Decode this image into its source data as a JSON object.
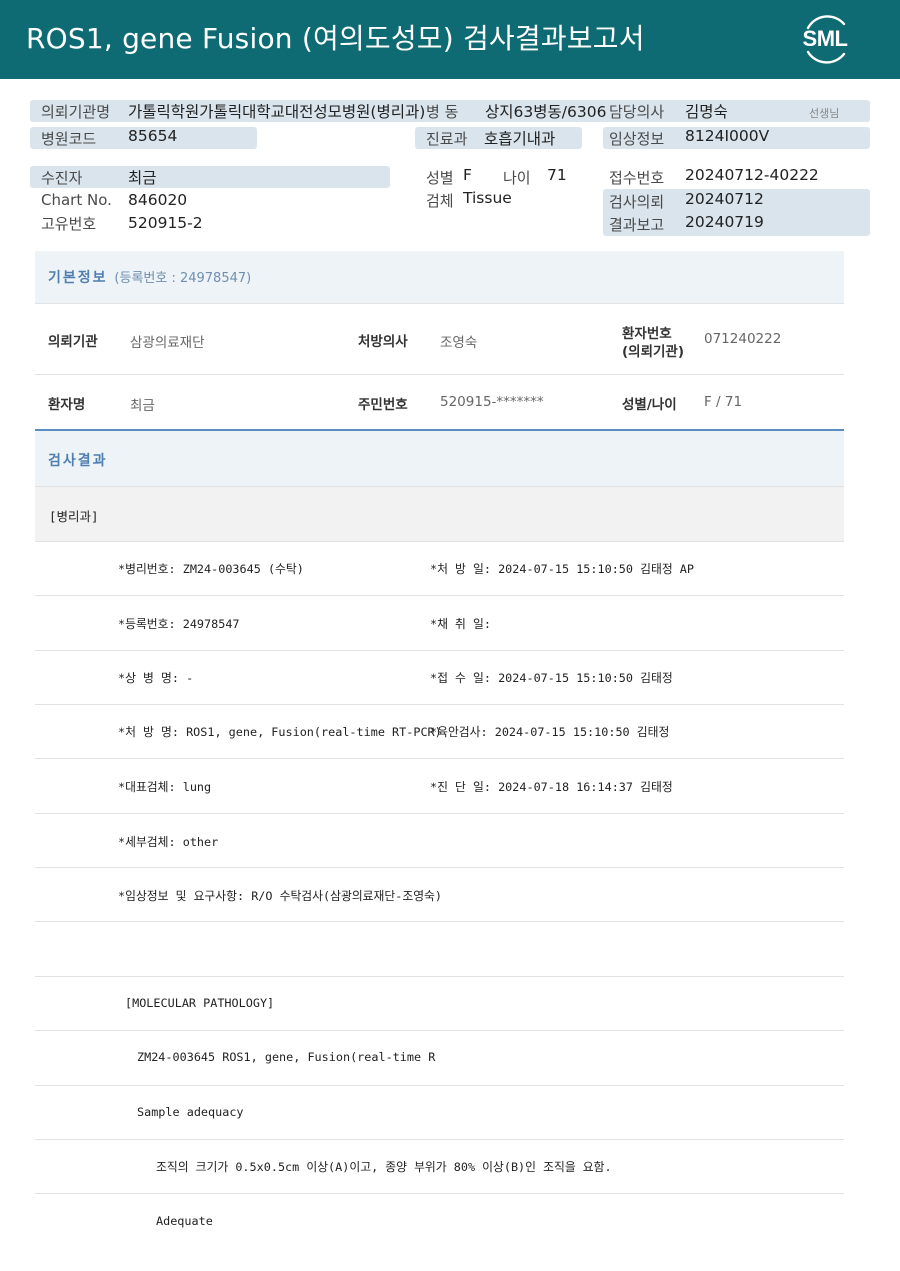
{
  "header": {
    "title": "ROS1, gene Fusion (여의도성모) 검사결과보고서",
    "logo_text": "SML",
    "bg_color": "#0e6b73"
  },
  "top_info": {
    "requester_label": "의뢰기관명",
    "requester_value": "가톨릭학원가톨릭대학교대전성모병원(병리과)",
    "ward_label": "병 동",
    "ward_value": "상지63병동/6306",
    "doctor_label": "담당의사",
    "doctor_value": "김명숙",
    "doctor_suffix": "선생님",
    "hospital_code_label": "병원코드",
    "hospital_code_value": "85654",
    "dept_label": "진료과",
    "dept_value": "호흡기내과",
    "clinical_label": "임상정보",
    "clinical_value": "8124I000V",
    "patient_label": "수진자",
    "patient_value": "최금",
    "chart_label": "Chart No.",
    "chart_value": "846020",
    "unique_label": "고유번호",
    "unique_value": "520915-2",
    "sex_label": "성별",
    "sex_value": "F",
    "age_label": "나이",
    "age_value": "71",
    "specimen_label": "검체",
    "specimen_value": "Tissue",
    "receipt_label": "접수번호",
    "receipt_value": "20240712-40222",
    "request_label": "검사의뢰",
    "request_value": "20240712",
    "report_label": "결과보고",
    "report_value": "20240719"
  },
  "basic_info": {
    "title": "기본정보",
    "reg_sub": "(등록번호 : 24978547)",
    "inst_label": "의뢰기관",
    "inst_value": "삼광의료재단",
    "presc_label": "처방의사",
    "presc_value": "조영숙",
    "ptno_label_1": "환자번호",
    "ptno_label_2": "(의뢰기관)",
    "ptno_value": "071240222",
    "name_label": "환자명",
    "name_value": "최금",
    "rrn_label": "주민번호",
    "rrn_value": "520915-*******",
    "sexage_label": "성별/나이",
    "sexage_value": "F / 71"
  },
  "results": {
    "title": "검사결과",
    "dept": "[병리과]",
    "rows": [
      {
        "left": "*병리번호: ZM24-003645 (수탁)",
        "right": "*처 방 일: 2024-07-15 15:10:50  김태정 AP"
      },
      {
        "left": "*등록번호: 24978547",
        "right": "*채 취 일:"
      },
      {
        "left": "*상 병 명: -",
        "right": "*접 수 일: 2024-07-15 15:10:50  김태정"
      },
      {
        "left": "*처 방 명: ROS1, gene, Fusion(real-time RT-PCR)",
        "right": "*육안검사: 2024-07-15 15:10:50  김태정"
      },
      {
        "left": "*대표검체: lung",
        "right": "*진 단 일: 2024-07-18 16:14:37  김태정"
      },
      {
        "left": "*세부검체: other",
        "right": ""
      },
      {
        "left": "*임상정보 및 요구사항: R/O 수탁검사(삼광의료재단-조영숙)",
        "right": ""
      }
    ],
    "mol_title": "[MOLECULAR PATHOLOGY]",
    "mol_line": "ZM24-003645     ROS1, gene, Fusion(real-time R",
    "adequacy_title": "Sample adequacy",
    "adequacy_text": "조직의 크기가 0.5x0.5cm 이상(A)이고, 종양 부위가 80% 이상(B)인 조직을 요함.",
    "adequacy_result": "Adequate"
  }
}
